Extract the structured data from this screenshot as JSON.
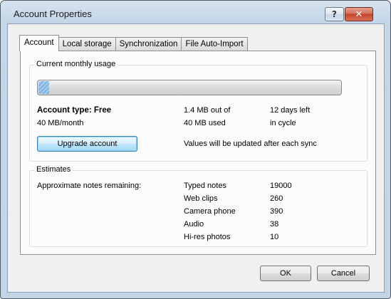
{
  "window": {
    "title": "Account Properties",
    "help_glyph": "?",
    "close_glyph": "✕"
  },
  "tabs": [
    {
      "label": "Account",
      "active": true
    },
    {
      "label": "Local storage",
      "active": false
    },
    {
      "label": "Synchronization",
      "active": false
    },
    {
      "label": "File Auto-Import",
      "active": false
    }
  ],
  "usage": {
    "group_label": "Current monthly usage",
    "progress_fraction": 0.035,
    "account_type": "Account type: Free",
    "quota": "40 MB/month",
    "used_line1": "1.4 MB out of",
    "used_line2": "40 MB used",
    "days_line1": "12 days left",
    "days_line2": "in cycle",
    "upgrade_label": "Upgrade account",
    "update_note": "Values will be updated after each sync"
  },
  "estimates": {
    "group_label": "Estimates",
    "remaining_label": "Approximate notes remaining:",
    "rows": [
      {
        "type": "Typed notes",
        "count": "19000"
      },
      {
        "type": "Web clips",
        "count": "260"
      },
      {
        "type": "Camera phone",
        "count": "390"
      },
      {
        "type": "Audio",
        "count": "38"
      },
      {
        "type": "Hi-res photos",
        "count": "10"
      }
    ]
  },
  "footer": {
    "ok_label": "OK",
    "cancel_label": "Cancel"
  }
}
